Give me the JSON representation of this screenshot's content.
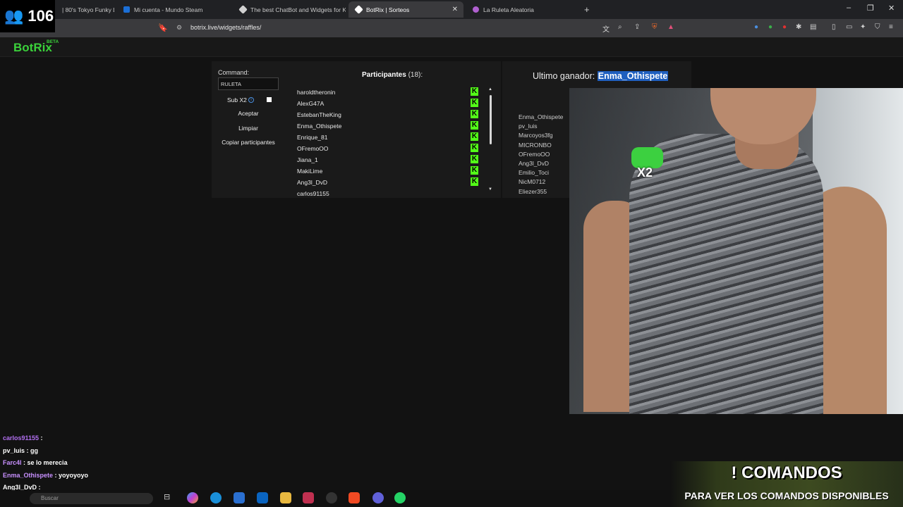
{
  "overlay": {
    "viewer_count": "106"
  },
  "browser": {
    "tabs": [
      {
        "label": "| 80's Tokyo Funky Lo",
        "color": "#888888"
      },
      {
        "label": "Mi cuenta - Mundo Steam",
        "color": "#1b6fd6"
      },
      {
        "label": "The best ChatBot and Widgets for Ki",
        "color": "#d0d0d0"
      },
      {
        "label": "BotRix | Sorteos",
        "color": "#ffffff",
        "active": true
      },
      {
        "label": "La Ruleta Aleatoria",
        "color": "#b060d0"
      }
    ],
    "url": "botrix.live/widgets/raffles/"
  },
  "site": {
    "logo": "BotRix",
    "beta": "BETA"
  },
  "controls": {
    "command_label": "Command:",
    "command_value": "RULETA",
    "sub_label": "Sub X2",
    "sub_info": "i",
    "accept": "Aceptar",
    "clear": "Limpiar",
    "copy": "Copiar participantes"
  },
  "participants": {
    "title": "Participantes",
    "count": "(18):",
    "badge": "K",
    "items": [
      "haroldtheronin",
      "AlexG47A",
      "EstebanTheKing",
      "Enma_Othispete",
      "Enrique_81",
      "OFremoOO",
      "Jiana_1",
      "MakiLime",
      "Ang3l_DvD",
      "carlos91155"
    ]
  },
  "winner": {
    "label": "Ultimo ganador:",
    "name": "Enma_Othispete",
    "history": [
      "Enma_Othispete",
      "pv_luis",
      "Marcoyos3fg",
      "MICRONBO",
      "OFremoOO",
      "Ang3l_DvD",
      "Emilio_Toci",
      "NicM0712",
      "Eliezer355"
    ]
  },
  "chat": [
    {
      "user": "carlos91155",
      "msg": ""
    },
    {
      "user": "pv_luis",
      "msg": "gg"
    },
    {
      "user": "Farc4l",
      "msg": "se lo merecia"
    },
    {
      "user": "Enma_Othispete",
      "msg": "yoyoyoyo"
    },
    {
      "user": "Ang3l_DvD",
      "msg": ""
    }
  ],
  "taskbar": {
    "search_placeholder": "Buscar"
  },
  "banner": {
    "title": "! COMANDOS",
    "subtitle": "PARA VER LOS COMANDOS DISPONIBLES"
  },
  "emote": {
    "label": "X2"
  }
}
